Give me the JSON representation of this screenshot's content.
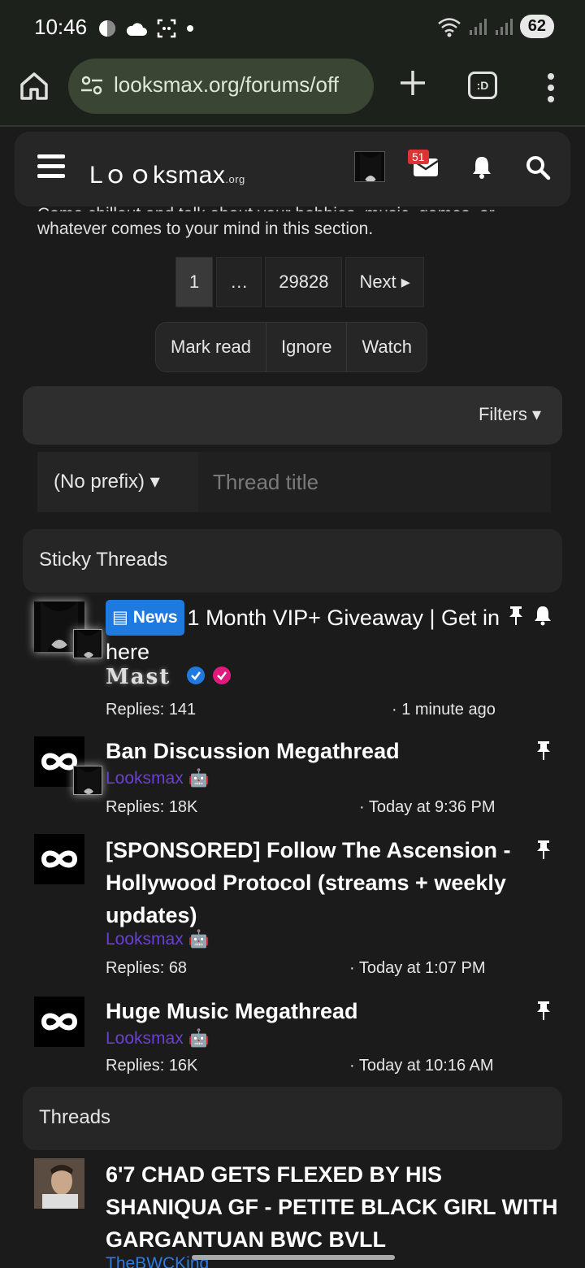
{
  "status_bar": {
    "time": "10:46",
    "battery": "62"
  },
  "browser": {
    "url": "looksmax.org/forums/off",
    "tabs_icon_text": ":D"
  },
  "site_header": {
    "logo": "Lｏｏksmax",
    "logo_suffix": ".org",
    "mail_badge": "51"
  },
  "forum": {
    "description_clipped": "Come chillout and talk about your hobbies, music, games, or",
    "description": "whatever comes to your mind in this section."
  },
  "pagination": {
    "pages": [
      "1",
      "…",
      "29828"
    ],
    "next": "Next ▸"
  },
  "actions": {
    "mark_read": "Mark read",
    "ignore": "Ignore",
    "watch": "Watch"
  },
  "filters": {
    "label": "Filters ▾",
    "prefix": "(No prefix)",
    "title_placeholder": "Thread title"
  },
  "sections": {
    "sticky": "Sticky Threads",
    "threads": "Threads"
  },
  "sticky_threads": [
    {
      "badge": "News",
      "title": "1 Month VIP+ Giveaway | Get in here",
      "author": "Mast",
      "replies": "Replies: 141",
      "time": "· 1 minute ago"
    },
    {
      "title": "Ban Discussion Megathread",
      "author": "Looksmax",
      "replies": "Replies: 18K",
      "time": "· Today at 9:36 PM"
    },
    {
      "title": "[SPONSORED] Follow The Ascension - Hollywood Protocol (streams + weekly updates)",
      "author": "Looksmax",
      "replies": "Replies: 68",
      "time": "· Today at 1:07 PM"
    },
    {
      "title": "Huge Music Megathread",
      "author": "Looksmax",
      "replies": "Replies: 16K",
      "time": "· Today at 10:16 AM"
    }
  ],
  "threads": [
    {
      "title": "6'7 CHAD GETS FLEXED BY HIS SHANIQUA GF - PETITE BLACK GIRL WITH GARGANTUAN BWC BVLL",
      "author": "TheBWCKing"
    }
  ],
  "colors": {
    "accent_blue": "#1f7ae0",
    "author_purple": "#6a3ed8",
    "badge_red": "#d33333",
    "magenta_verify": "#e0197d"
  }
}
